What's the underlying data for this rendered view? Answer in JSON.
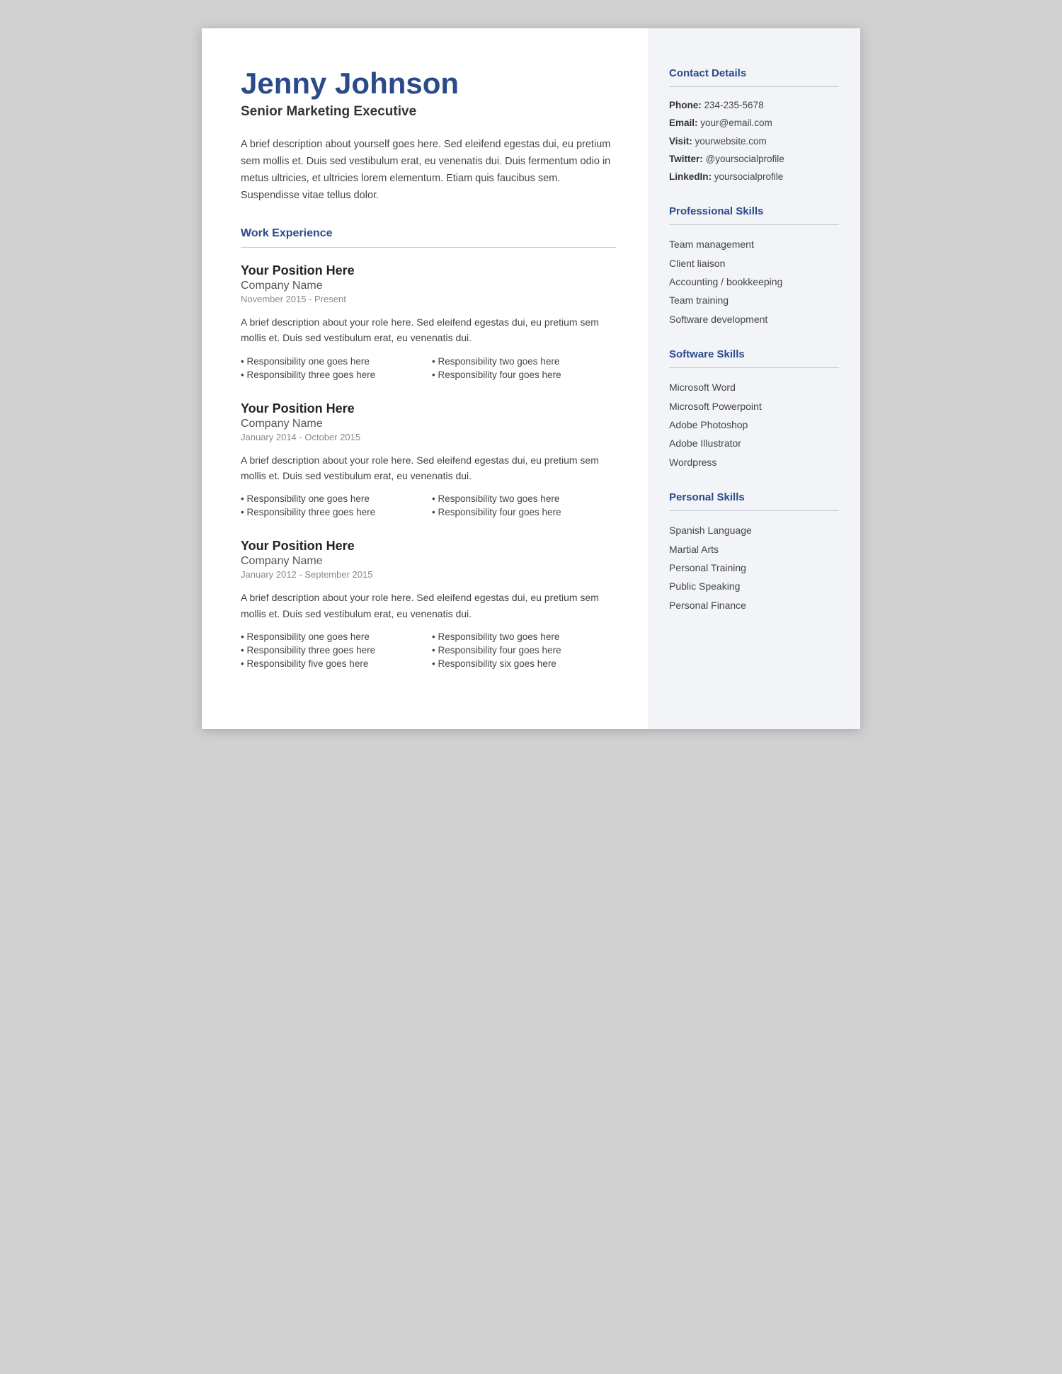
{
  "header": {
    "name": "Jenny Johnson",
    "title": "Senior Marketing Executive",
    "bio": "A brief description about yourself goes here. Sed eleifend egestas dui, eu pretium sem mollis et. Duis sed vestibulum erat, eu venenatis dui. Duis fermentum odio in metus ultricies, et ultricies lorem elementum. Etiam quis faucibus sem. Suspendisse vitae tellus dolor."
  },
  "work_experience": {
    "heading": "Work Experience",
    "jobs": [
      {
        "title": "Your Position Here",
        "company": "Company Name",
        "dates": "November 2015 - Present",
        "description": "A brief description about your role here. Sed eleifend egestas dui, eu pretium sem mollis et. Duis sed vestibulum erat, eu venenatis dui.",
        "responsibilities": [
          "Responsibility one goes here",
          "Responsibility two goes here",
          "Responsibility three goes here",
          "Responsibility four goes here"
        ]
      },
      {
        "title": "Your Position Here",
        "company": "Company Name",
        "dates": "January 2014 - October 2015",
        "description": "A brief description about your role here. Sed eleifend egestas dui, eu pretium sem mollis et. Duis sed vestibulum erat, eu venenatis dui.",
        "responsibilities": [
          "Responsibility one goes here",
          "Responsibility two goes here",
          "Responsibility three goes here",
          "Responsibility four goes here"
        ]
      },
      {
        "title": "Your Position Here",
        "company": "Company Name",
        "dates": "January 2012 - September 2015",
        "description": "A brief description about your role here. Sed eleifend egestas dui, eu pretium sem mollis et. Duis sed vestibulum erat, eu venenatis dui.",
        "responsibilities": [
          "Responsibility one goes here",
          "Responsibility two goes here",
          "Responsibility three goes here",
          "Responsibility four goes here",
          "Responsibility five goes here",
          "Responsibility six goes here"
        ]
      }
    ]
  },
  "sidebar": {
    "contact": {
      "heading": "Contact Details",
      "items": [
        {
          "label": "Phone:",
          "value": "234-235-5678"
        },
        {
          "label": "Email:",
          "value": "your@email.com"
        },
        {
          "label": "Visit:",
          "value": " yourwebsite.com"
        },
        {
          "label": "Twitter:",
          "value": "@yoursocialprofile"
        },
        {
          "label": "LinkedIn:",
          "value": "yoursocialprofile"
        }
      ]
    },
    "professional_skills": {
      "heading": "Professional Skills",
      "items": [
        "Team management",
        "Client liaison",
        "Accounting / bookkeeping",
        "Team training",
        "Software development"
      ]
    },
    "software_skills": {
      "heading": "Software Skills",
      "items": [
        "Microsoft Word",
        "Microsoft Powerpoint",
        "Adobe Photoshop",
        "Adobe Illustrator",
        "Wordpress"
      ]
    },
    "personal_skills": {
      "heading": "Personal Skills",
      "items": [
        "Spanish Language",
        "Martial Arts",
        "Personal Training",
        "Public Speaking",
        "Personal Finance"
      ]
    }
  }
}
